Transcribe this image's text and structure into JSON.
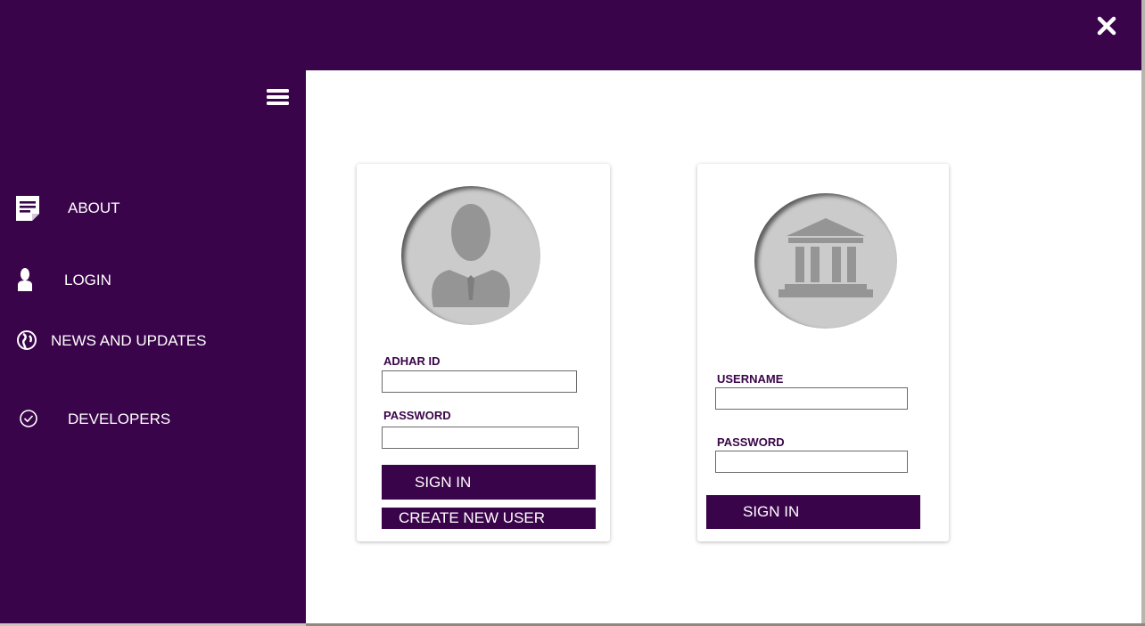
{
  "window": {
    "close_icon": "close-icon"
  },
  "sidebar": {
    "menu_icon": "hamburger-menu-icon",
    "items": [
      {
        "label": "ABOUT",
        "icon": "document-icon"
      },
      {
        "label": "LOGIN",
        "icon": "person-icon"
      },
      {
        "label": "NEWS AND UPDATES",
        "icon": "globe-icon"
      },
      {
        "label": "DEVELOPERS",
        "icon": "check-circle-icon"
      }
    ]
  },
  "user_login": {
    "avatar_icon": "user-avatar-icon",
    "id_label": "ADHAR ID",
    "id_value": "",
    "password_label": "PASSWORD",
    "password_value": "",
    "sign_in_label": "SIGN IN",
    "create_user_label": "CREATE NEW USER"
  },
  "institution_login": {
    "avatar_icon": "bank-building-icon",
    "username_label": "USERNAME",
    "username_value": "",
    "password_label": "PASSWORD",
    "password_value": "",
    "sign_in_label": "SIGN IN"
  },
  "colors": {
    "brand": "#3a044a",
    "background": "#ffffff",
    "avatar_gray": "#cbcbcb",
    "icon_gray": "#959595"
  }
}
